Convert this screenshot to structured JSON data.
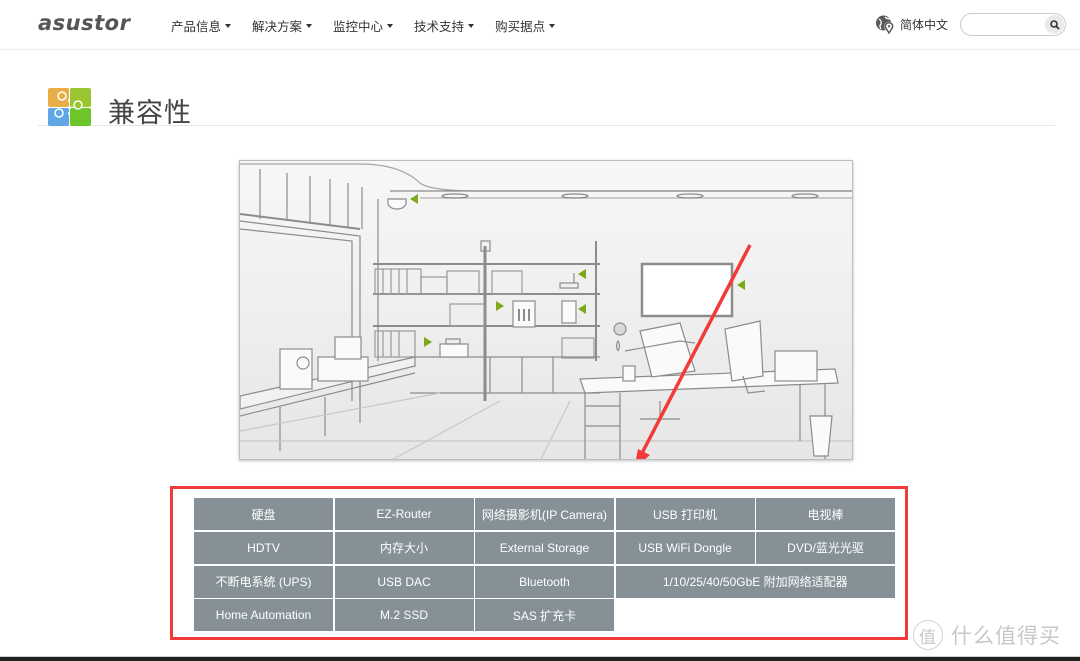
{
  "header": {
    "logo": "asustor",
    "nav": [
      {
        "label": "产品信息"
      },
      {
        "label": "解决方案"
      },
      {
        "label": "监控中心"
      },
      {
        "label": "技术支持"
      },
      {
        "label": "购买据点"
      }
    ],
    "language": "简体中文",
    "search": {
      "value": "",
      "placeholder": ""
    }
  },
  "page": {
    "title": "兼容性",
    "icon": "puzzle-icon"
  },
  "illustration": {
    "description": "Home office scene with compatible devices marked by green arrows",
    "marker_color": "#7aa91a",
    "annotation_arrow_color": "#f23a3a"
  },
  "compatibility": {
    "highlight_color": "#f23a3a",
    "cell_color": "#869197",
    "items": [
      {
        "label": "硬盘"
      },
      {
        "label": "EZ-Router"
      },
      {
        "label": "网络摄影机(IP Camera)"
      },
      {
        "label": "USB 打印机"
      },
      {
        "label": "电视棒"
      },
      {
        "label": "HDTV"
      },
      {
        "label": "内存大小"
      },
      {
        "label": "External Storage"
      },
      {
        "label": "USB WiFi Dongle"
      },
      {
        "label": "DVD/蓝光光驱"
      },
      {
        "label": "不断电系统 (UPS)"
      },
      {
        "label": "USB DAC"
      },
      {
        "label": "Bluetooth"
      },
      {
        "label": "1/10/25/40/50GbE 附加网络适配器"
      },
      {
        "label": "Home Automation"
      },
      {
        "label": "M.2 SSD"
      },
      {
        "label": "SAS 扩充卡"
      }
    ]
  },
  "watermark": {
    "badge": "值",
    "text": "什么值得买"
  }
}
